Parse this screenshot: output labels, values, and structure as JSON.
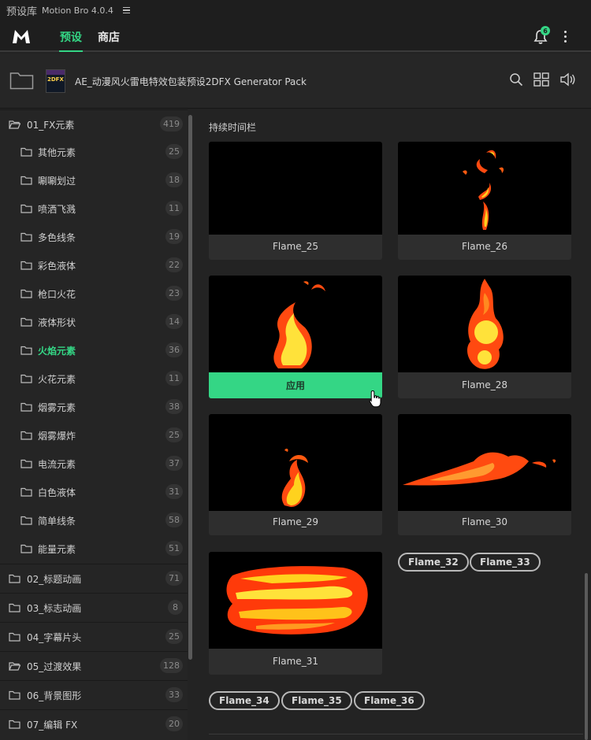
{
  "titlebar": {
    "title": "预设库",
    "app": "Motion Bro 4.0.4"
  },
  "nav": {
    "presets_tab": "预设",
    "store_tab": "商店",
    "notifications_count": "6"
  },
  "pack": {
    "name": "AE_动漫风火雷电特效包装预设2DFX Generator Pack",
    "thumb_text": "2DFX"
  },
  "sidebar": {
    "items": [
      {
        "label": "01_FX元素",
        "count": "419",
        "level": 0,
        "open": true
      },
      {
        "label": "其他元素",
        "count": "25",
        "level": 1
      },
      {
        "label": "唰唰划过",
        "count": "18",
        "level": 1
      },
      {
        "label": "喷洒飞溅",
        "count": "11",
        "level": 1
      },
      {
        "label": "多色线条",
        "count": "19",
        "level": 1
      },
      {
        "label": "彩色液体",
        "count": "22",
        "level": 1
      },
      {
        "label": "枪口火花",
        "count": "23",
        "level": 1
      },
      {
        "label": "液体形状",
        "count": "14",
        "level": 1
      },
      {
        "label": "火焰元素",
        "count": "36",
        "level": 1,
        "active": true
      },
      {
        "label": "火花元素",
        "count": "11",
        "level": 1
      },
      {
        "label": "烟雾元素",
        "count": "38",
        "level": 1
      },
      {
        "label": "烟雾爆炸",
        "count": "25",
        "level": 1
      },
      {
        "label": "电流元素",
        "count": "37",
        "level": 1
      },
      {
        "label": "白色液体",
        "count": "31",
        "level": 1
      },
      {
        "label": "简单线条",
        "count": "58",
        "level": 1
      },
      {
        "label": "能量元素",
        "count": "51",
        "level": 1
      },
      {
        "label": "02_标题动画",
        "count": "71",
        "level": 0
      },
      {
        "label": "03_标志动画",
        "count": "8",
        "level": 0
      },
      {
        "label": "04_字幕片头",
        "count": "25",
        "level": 0
      },
      {
        "label": "05_过渡效果",
        "count": "128",
        "level": 0,
        "open": true
      },
      {
        "label": "06_背景图形",
        "count": "33",
        "level": 0
      },
      {
        "label": "07_编辑 FX",
        "count": "20",
        "level": 0
      }
    ]
  },
  "main": {
    "section_title": "持续时间栏",
    "apply_label": "应用",
    "cards": [
      {
        "name": "Flame_25"
      },
      {
        "name": "Flame_26"
      },
      {
        "name": "",
        "hovered": true
      },
      {
        "name": "Flame_28"
      },
      {
        "name": "Flame_29"
      },
      {
        "name": "Flame_30"
      },
      {
        "name": "Flame_31"
      }
    ],
    "chips": [
      "Flame_32",
      "Flame_33",
      "Flame_34",
      "Flame_35",
      "Flame_36"
    ]
  },
  "colors": {
    "accent": "#34d685",
    "flame_orange": "#ff5a10",
    "flame_yellow": "#ffe23a"
  }
}
